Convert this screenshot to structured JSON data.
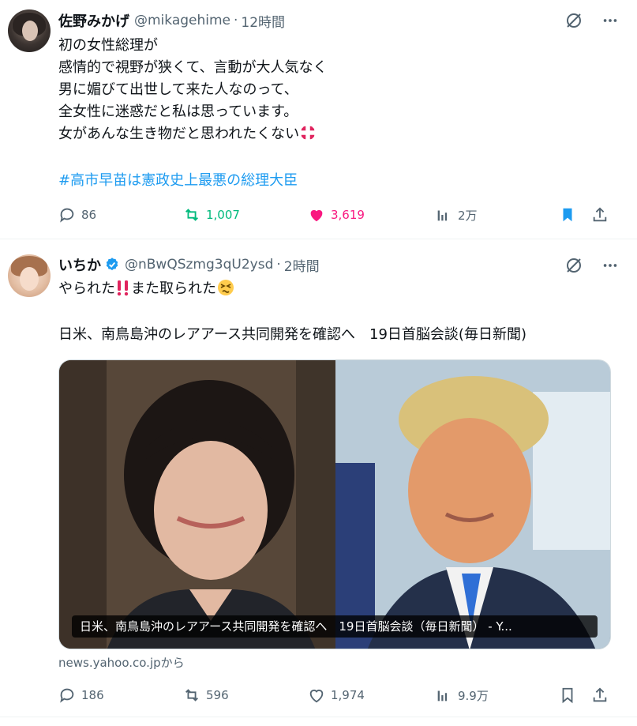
{
  "tweets": [
    {
      "author": {
        "name": "佐野みかげ",
        "handle": "@mikagehime",
        "time": "12時間"
      },
      "lines": [
        "初の女性総理が",
        "感情的で視野が狭くて、言動が大人気なく",
        "男に媚びて出世して来た人なのって、",
        "全女性に迷惑だと私は思っています。",
        "女があんな生き物だと思われたくない"
      ],
      "hashtag": "#高市早苗は憲政史上最悪の総理大臣",
      "stats": {
        "replies": "86",
        "retweets": "1,007",
        "likes": "3,619",
        "views": "2万"
      },
      "colors": {
        "retweet_active": "#00ba7c",
        "like_active": "#f91880",
        "bookmark_active": "#1d9bf0"
      }
    },
    {
      "author": {
        "name": "いちか",
        "handle": "@nBwQSzmg3qU2ysd",
        "time": "2時間",
        "verified": true
      },
      "line1_a": "やられた",
      "line1_b": "また取られた",
      "line2": "日米、南鳥島沖のレアアース共同開発を確認へ　19日首脳会談(毎日新聞)",
      "media_caption": "日米、南鳥島沖のレアアース共同開発を確認へ　19日首脳会談（毎日新聞） - Y...",
      "source": "news.yahoo.co.jpから",
      "stats": {
        "replies": "186",
        "retweets": "596",
        "likes": "1,974",
        "views": "9.9万"
      }
    }
  ],
  "icons": [
    "grok-icon",
    "more-icon",
    "reply-icon",
    "retweet-icon",
    "like-icon",
    "views-icon",
    "bookmark-icon",
    "share-icon",
    "verified-badge-icon",
    "anger-emoji-icon",
    "double-exclamation-icon",
    "persevering-face-icon"
  ],
  "colors": {
    "text": "#0f1419",
    "secondary": "#536471",
    "link": "#1d9bf0",
    "divider": "#eff3f4"
  }
}
